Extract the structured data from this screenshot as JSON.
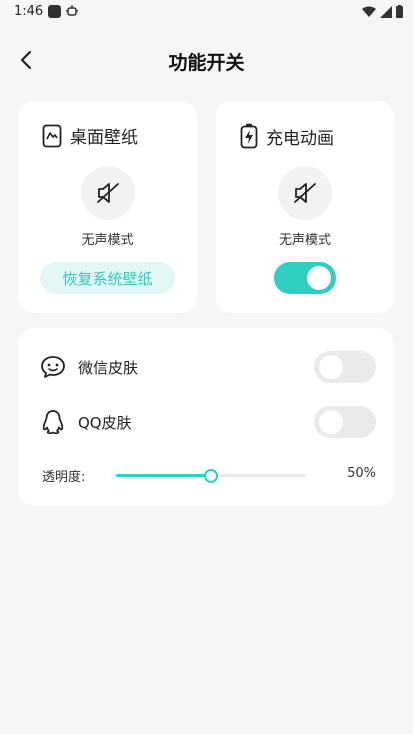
{
  "status_bar": {
    "time": "1:46"
  },
  "header": {
    "title": "功能开关"
  },
  "wallpaper_card": {
    "title": "桌面壁纸",
    "mode_label": "无声模式",
    "restore_label": "恢复系统壁纸"
  },
  "charge_card": {
    "title": "充电动画",
    "mode_label": "无声模式",
    "switch_on": true
  },
  "skin_card": {
    "wechat_label": "微信皮肤",
    "wechat_on": false,
    "qq_label": "QQ皮肤",
    "qq_on": false,
    "opacity_label": "透明度:",
    "opacity_value": "50%",
    "opacity_fraction": 0.5
  },
  "colors": {
    "accent": "#2ecfc1",
    "accent_soft": "#e3f7f5",
    "background": "#f5f6f8"
  },
  "icons": [
    "back-icon",
    "wallpaper-icon",
    "battery-charge-icon",
    "mute-icon",
    "wechat-icon",
    "qq-icon"
  ]
}
